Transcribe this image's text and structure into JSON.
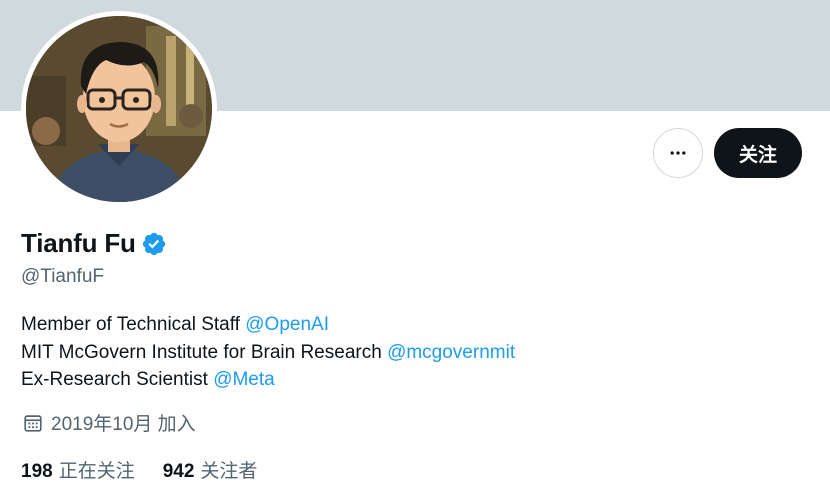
{
  "banner": {
    "color": "#cfd9de"
  },
  "profile": {
    "name": "Tianfu Fu",
    "handle": "@TianfuF",
    "verified": true,
    "verified_color": "#1d9bf0"
  },
  "actions": {
    "more_icon": "more-horizontal-icon",
    "follow_label": "关注"
  },
  "bio": {
    "lines": [
      {
        "text": "Member of Technical Staff ",
        "mention": "@OpenAI"
      },
      {
        "text": "MIT McGovern Institute for Brain Research ",
        "mention": "@mcgovernmit"
      },
      {
        "text": "Ex-Research Scientist ",
        "mention": "@Meta"
      }
    ]
  },
  "joined": {
    "icon": "calendar-icon",
    "text": "2019年10月 加入"
  },
  "stats": {
    "following_count": "198",
    "following_label": "正在关注",
    "followers_count": "942",
    "followers_label": "关注者"
  },
  "colors": {
    "text": "#0f1419",
    "secondary": "#536471",
    "link": "#1d9bf0",
    "button_bg": "#0f1419"
  }
}
